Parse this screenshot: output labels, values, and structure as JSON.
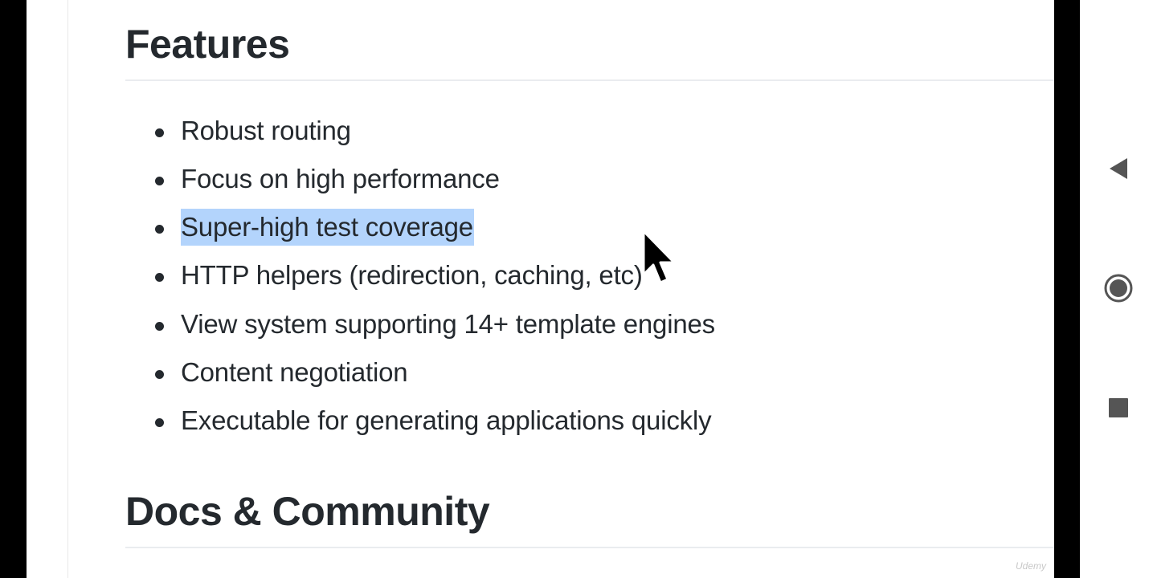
{
  "features": {
    "heading": "Features",
    "items": [
      {
        "text": "Robust routing",
        "selected": false
      },
      {
        "text": "Focus on high performance",
        "selected": false
      },
      {
        "text": "Super-high test coverage",
        "selected": true
      },
      {
        "text": "HTTP helpers (redirection, caching, etc)",
        "selected": false
      },
      {
        "text": "View system supporting 14+ template engines",
        "selected": false
      },
      {
        "text": "Content negotiation",
        "selected": false
      },
      {
        "text": "Executable for generating applications quickly",
        "selected": false
      }
    ]
  },
  "docs": {
    "heading": "Docs & Community"
  },
  "watermark": "Udemy",
  "nav": {
    "back_icon": "triangle-back-icon",
    "home_icon": "circle-home-icon",
    "recents_icon": "square-recents-icon"
  },
  "colors": {
    "text": "#24292e",
    "selection": "#b3d4fc",
    "rule": "#eaecef",
    "nav_icon": "#555555"
  }
}
